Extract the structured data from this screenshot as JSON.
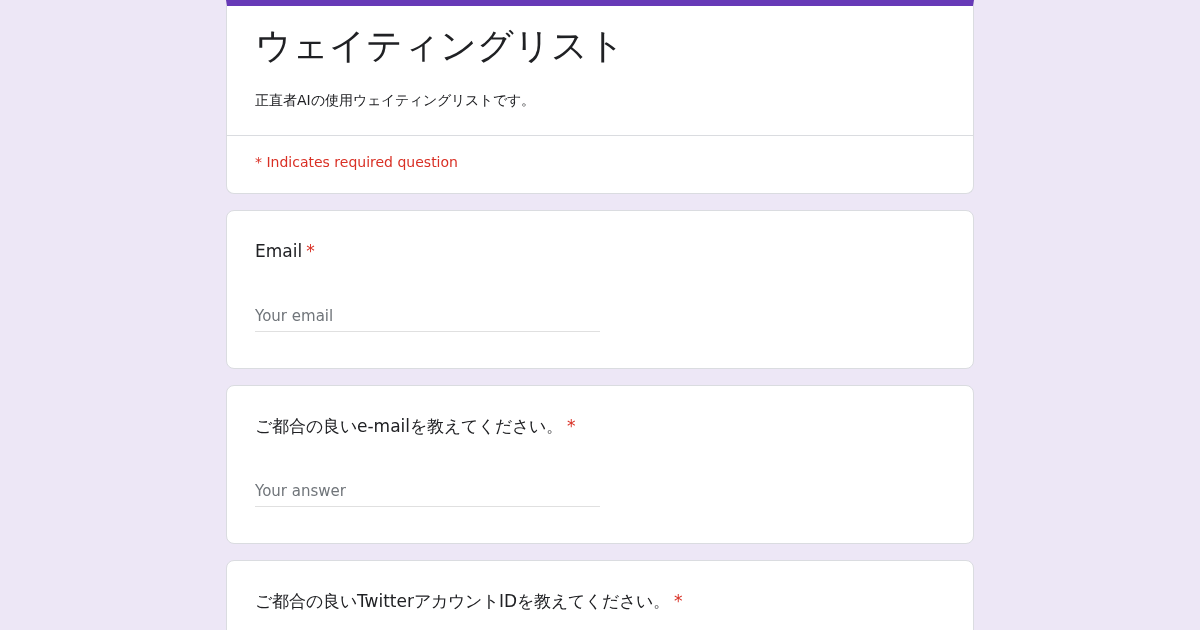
{
  "form": {
    "title": "ウェイティングリスト",
    "description": "正直者AIの使用ウェイティングリストです。",
    "required_note": "* Indicates required question"
  },
  "questions": [
    {
      "label": "Email",
      "required": true,
      "required_mark": "*",
      "placeholder": "Your email"
    },
    {
      "label": "ご都合の良いe-mailを教えてください。",
      "required": true,
      "required_mark": "*",
      "placeholder": "Your answer"
    },
    {
      "label": "ご都合の良いTwitterアカウントIDを教えてください。",
      "required": true,
      "required_mark": "*"
    }
  ]
}
